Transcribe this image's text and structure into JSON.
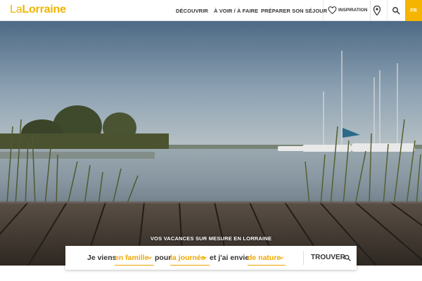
{
  "header": {
    "logo_prefix": "La",
    "logo_main": "Lorraine",
    "nav": [
      {
        "label": "DÉCOUVRIR"
      },
      {
        "label": "À VOIR / À FAIRE"
      },
      {
        "label": "PRÉPARER SON SÉJOUR"
      }
    ],
    "inspiration_label": "INSPIRATION",
    "lang_label": "FR"
  },
  "hero": {
    "tagline": "VOS VACANCES SUR MESURE EN LORRAINE"
  },
  "search_bar": {
    "t1": "Je viens",
    "s1": "en famille",
    "t2": "pour",
    "s2": "la journée",
    "t3": "et j'ai envie",
    "s3": "de nature",
    "button": "TROUVER"
  },
  "colors": {
    "brand": "#f5b400",
    "text": "#333333"
  },
  "icons": [
    "heart-icon",
    "location-pin-icon",
    "search-icon",
    "chevron-down-icon"
  ]
}
